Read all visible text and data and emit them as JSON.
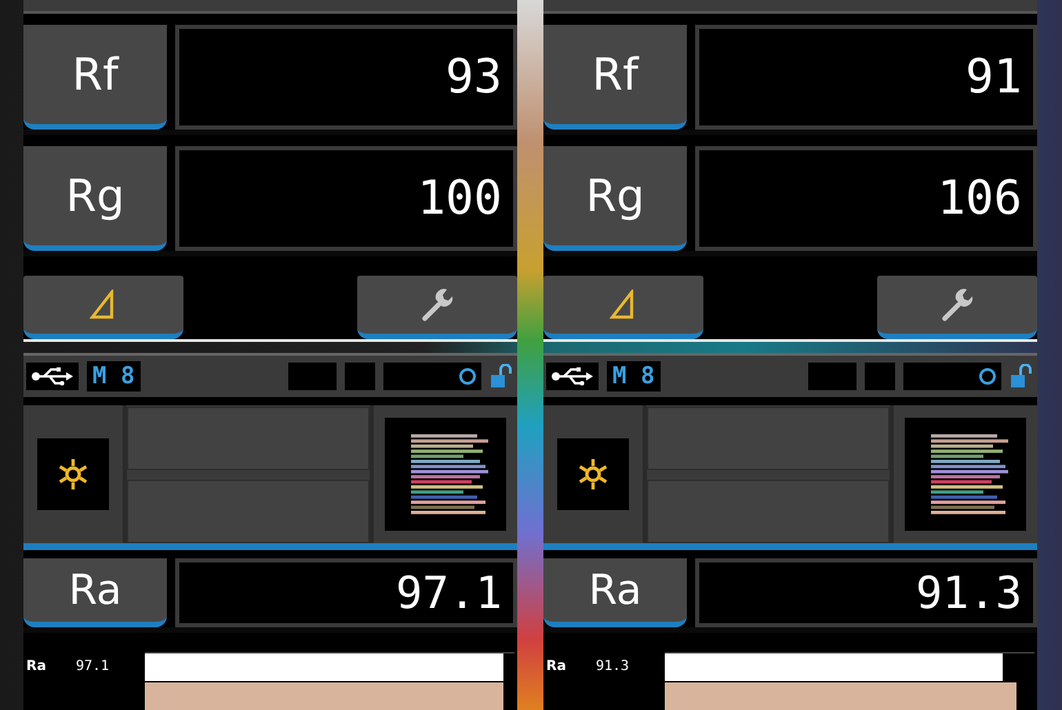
{
  "panels": [
    {
      "readings": [
        {
          "label": "Rf",
          "value": "93"
        },
        {
          "label": "Rg",
          "value": "100"
        }
      ],
      "status": {
        "mode": "M 8"
      },
      "main": {
        "label": "Ra",
        "value": "97.1"
      },
      "bars": [
        {
          "label": "Ra",
          "value": "97.1",
          "level": 0.971,
          "color": "#ffffff"
        },
        {
          "level": 0.97,
          "color": "#d9b49c"
        }
      ]
    },
    {
      "readings": [
        {
          "label": "Rf",
          "value": "91"
        },
        {
          "label": "Rg",
          "value": "106"
        }
      ],
      "status": {
        "mode": "M 8"
      },
      "main": {
        "label": "Ra",
        "value": "91.3"
      },
      "bars": [
        {
          "label": "Ra",
          "value": "91.3",
          "level": 0.913,
          "color": "#ffffff"
        },
        {
          "level": 0.95,
          "color": "#d9b49c"
        }
      ]
    }
  ]
}
